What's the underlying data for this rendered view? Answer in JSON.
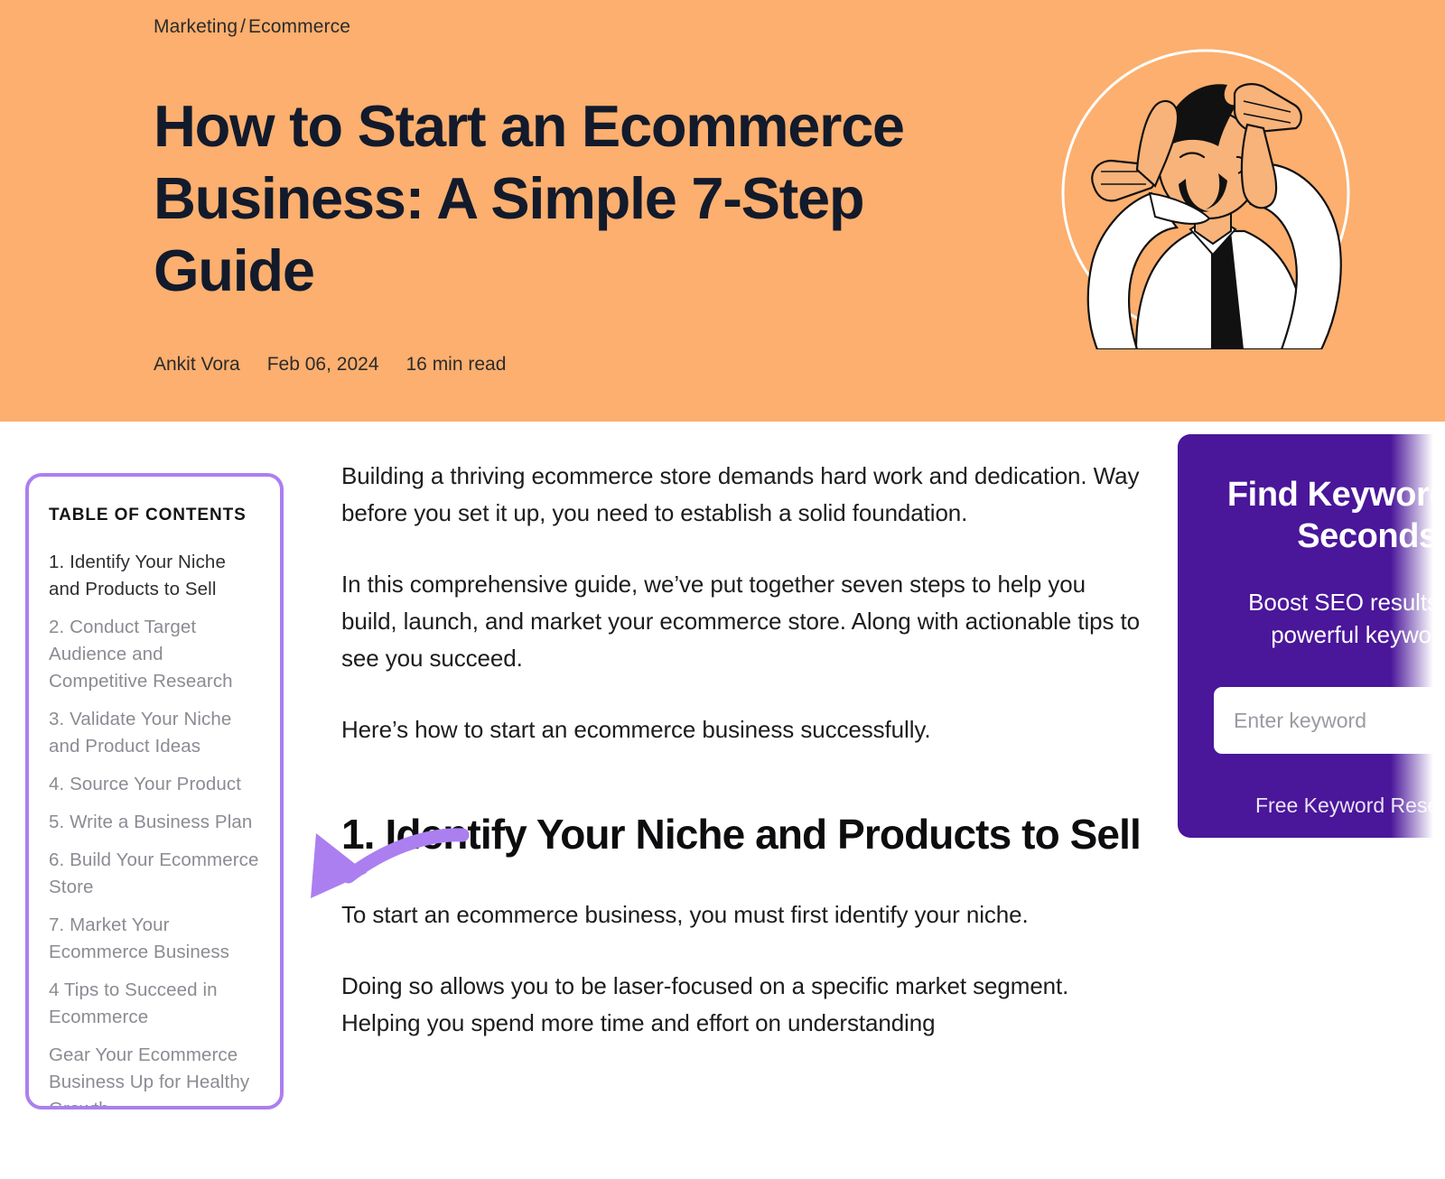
{
  "hero": {
    "breadcrumb": {
      "parent": "Marketing",
      "separator": "/",
      "child": "Ecommerce"
    },
    "title": "How to Start an Ecommerce Business: A Simple 7-Step Guide",
    "author": "Ankit Vora",
    "date": "Feb 06, 2024",
    "read_time": "16 min read",
    "background_color": "#fcaf6e",
    "title_color": "#121a2b",
    "illustration_name": "person-framing-hands-illustration"
  },
  "annotation": {
    "arrow_color": "#ab7ff0",
    "points_to": "table-of-contents"
  },
  "toc": {
    "heading": "TABLE OF CONTENTS",
    "border_color": "#ab7ff0",
    "active_index": 0,
    "items": [
      "1. Identify Your Niche and Products to Sell",
      "2. Conduct Target Audience and Competitive Research",
      "3. Validate Your Niche and Product Ideas",
      "4. Source Your Product",
      "5. Write a Business Plan",
      "6. Build Your Ecommerce Store",
      "7. Market Your Ecommerce Business",
      "4 Tips to Succeed in Ecommerce",
      "Gear Your Ecommerce Business Up for Healthy Growth"
    ]
  },
  "article": {
    "paragraph_1": "Building a thriving ecommerce store demands hard work and dedication. Way before you set it up, you need to establish a solid foundation.",
    "paragraph_2": "In this comprehensive guide, we’ve put together seven steps to help you build, launch, and market your ecommerce store. Along with actionable tips to see you succeed.",
    "paragraph_3": "Here’s how to start an ecommerce business successfully.",
    "section_heading": "1. Identify Your Niche and Products to Sell",
    "paragraph_4": "To start an ecommerce business, you must first identify your niche.",
    "paragraph_5": "Doing so allows you to be laser-focused on a specific market segment. Helping you spend more time and effort on understanding"
  },
  "cta": {
    "title": "Find Keywords in Seconds",
    "subtitle": "Boost SEO results with powerful keywords",
    "input_placeholder": "Enter keyword",
    "input_value": "",
    "button_label": "Free Keyword Research",
    "background_color": "#4a169a"
  }
}
